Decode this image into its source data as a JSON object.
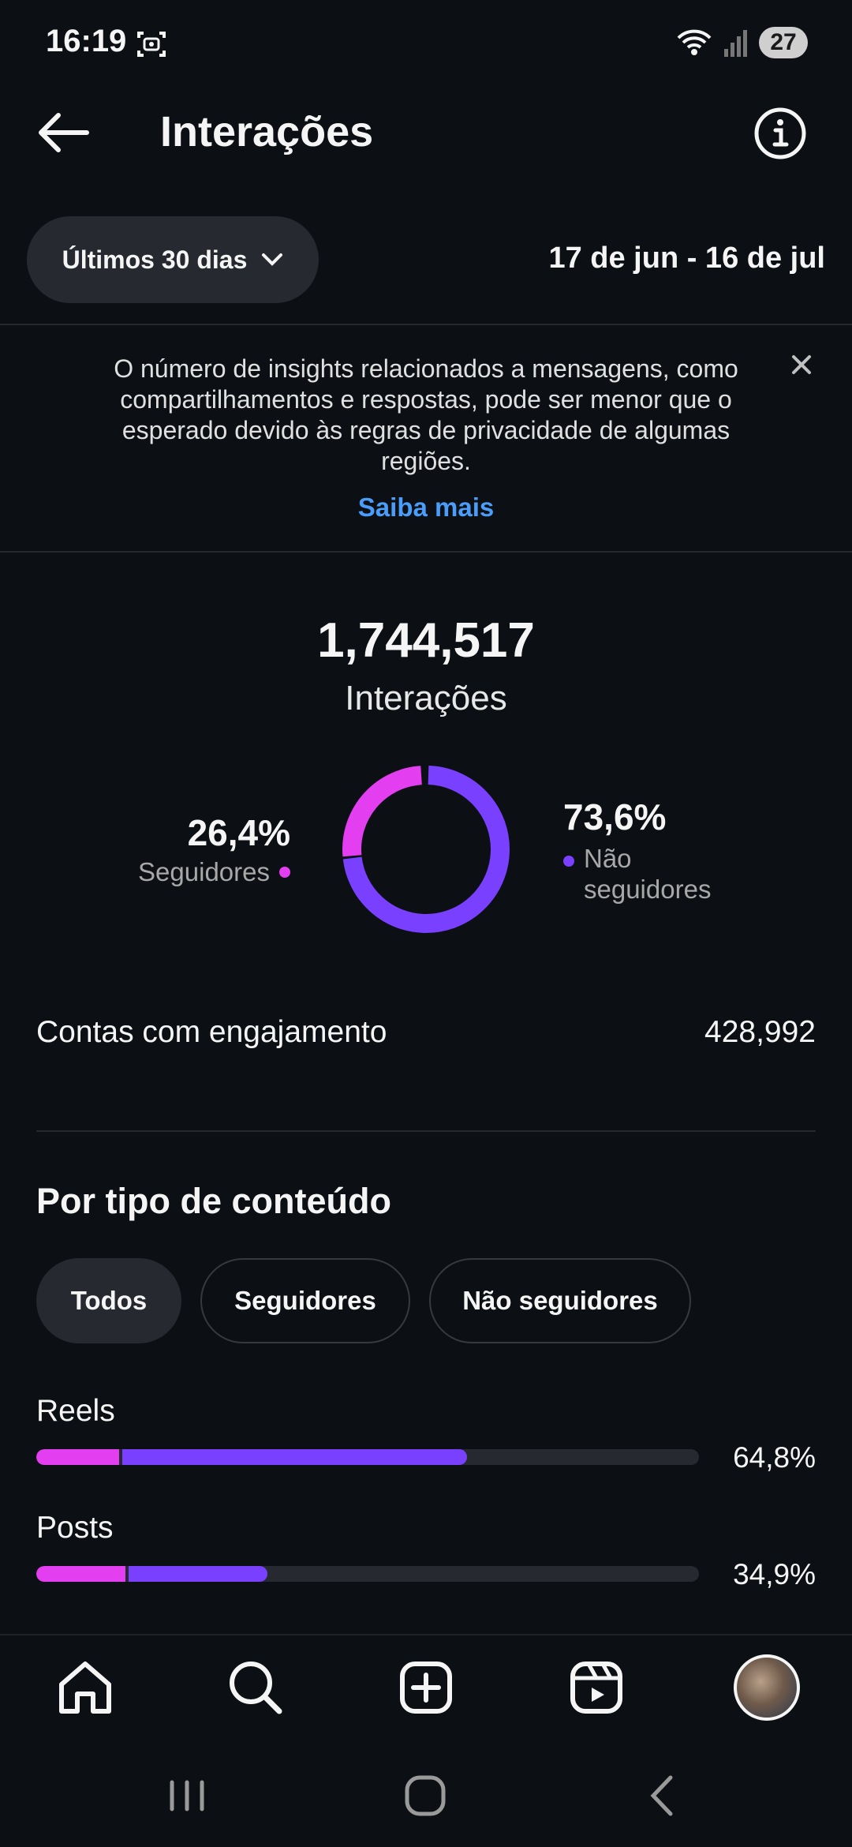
{
  "status_bar": {
    "time": "16:19",
    "battery": "27"
  },
  "header": {
    "title": "Interações"
  },
  "period": {
    "label": "Últimos 30 dias",
    "range": "17 de jun - 16 de jul"
  },
  "notice": {
    "text": "O número de insights relacionados a mensagens, como compartilhamentos e respostas, pode ser menor que o esperado devido às regras de privacidade de algumas regiões.",
    "link": "Saiba mais"
  },
  "summary": {
    "total": "1,744,517",
    "total_label": "Interações",
    "followers_pct": "26,4%",
    "followers_label": "Seguidores",
    "nonfollowers_pct": "73,6%",
    "nonfollowers_label": "Não seguidores",
    "followers_share": 0.264,
    "nonfollowers_share": 0.736,
    "colors": {
      "followers": "#e33ff0",
      "nonfollowers": "#7a40ff"
    }
  },
  "engaged": {
    "label": "Contas com engajamento",
    "value": "428,992"
  },
  "content_type": {
    "title": "Por tipo de conteúdo",
    "filters": [
      "Todos",
      "Seguidores",
      "Não seguidores"
    ],
    "selected_filter": "Todos",
    "rows": [
      {
        "label": "Reels",
        "pct": "64,8%",
        "followers_share": 0.125,
        "nonfollowers_share": 0.525
      },
      {
        "label": "Posts",
        "pct": "34,9%",
        "followers_share": 0.135,
        "nonfollowers_share": 0.214
      }
    ]
  },
  "nav": {
    "items": [
      "home-icon",
      "search-icon",
      "create-icon",
      "reels-icon",
      "profile-avatar"
    ],
    "system": [
      "recents-icon",
      "home-circle-icon",
      "back-chevron-icon"
    ]
  }
}
